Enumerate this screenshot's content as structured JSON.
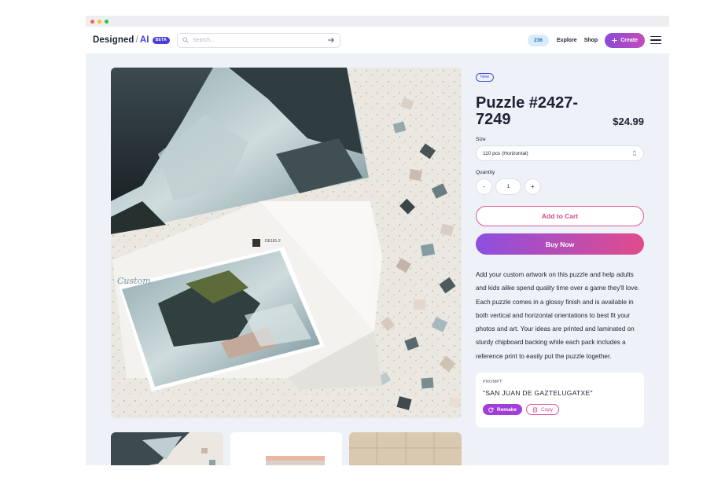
{
  "header": {
    "brand_main": "Designed",
    "brand_slash": "/",
    "brand_ai": "AI",
    "beta_label": "BETA",
    "search_placeholder": "Search...",
    "count_badge": "236",
    "nav_links": [
      "Explore",
      "Shop"
    ],
    "create_label": "Create"
  },
  "product": {
    "badge": "New",
    "title": "Puzzle #2427-7249",
    "price": "$24.99",
    "size_label": "Size",
    "size_value": "110 pcs (Horizontal)",
    "quantity_label": "Quantity",
    "quantity_value": "1",
    "minus_label": "-",
    "plus_label": "+",
    "add_to_cart_label": "Add to Cart",
    "buy_now_label": "Buy Now",
    "description": "Add your custom artwork on this puzzle and help adults and kids alike spend quality time over a game they'll love. Each puzzle comes in a glossy finish and is available in both vertical and horizontal orientations to best fit your photos and art. Your ideas are printed and laminated on sturdy chipboard backing while each pack includes a reference print to easily put the puzzle together."
  },
  "prompt": {
    "label": "PROMPT:",
    "text": "\"SAN JUAN DE GAZTELUGATXE\"",
    "remake_label": "Remake",
    "copy_label": "Copy"
  },
  "image": {
    "box_logo_text": "Custom"
  },
  "colors": {
    "accent_purple": "#4c3fd8",
    "gradient_start": "#8d4ee0",
    "gradient_end": "#e04c8c",
    "page_bg": "#eef1f7"
  },
  "icons": [
    "search-icon",
    "arrow-right-icon",
    "plus-icon",
    "menu-icon",
    "chevron-updown-icon",
    "refresh-icon",
    "copy-icon"
  ]
}
